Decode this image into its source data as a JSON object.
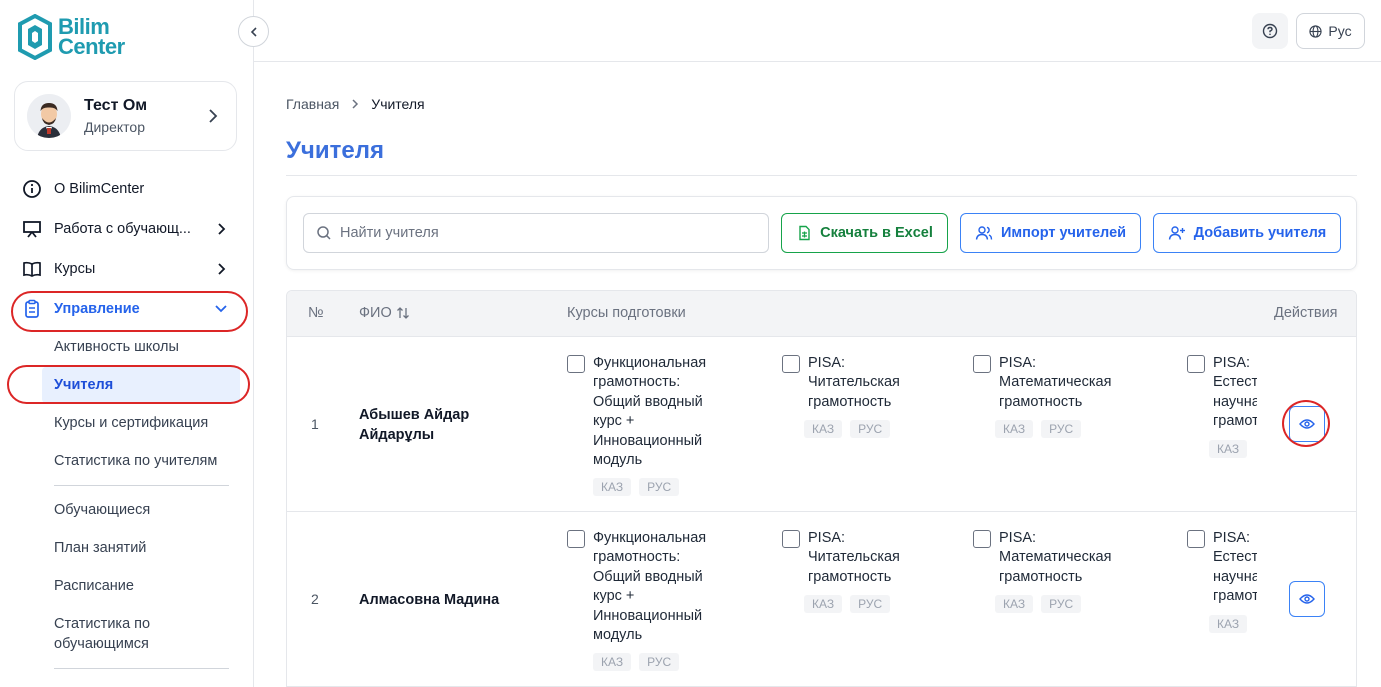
{
  "brand": {
    "line1": "Bilim",
    "line2": "Center"
  },
  "user": {
    "name": "Тест Ом",
    "role": "Директор"
  },
  "nav": {
    "about": "О BilimCenter",
    "work": "Работа с обучающ...",
    "courses": "Курсы",
    "management": "Управление"
  },
  "subnav": {
    "activity": "Активность школы",
    "teachers": "Учителя",
    "courses_cert": "Курсы и сертификация",
    "teacher_stats": "Статистика по учителям",
    "students": "Обучающиеся",
    "lesson_plan": "План занятий",
    "schedule": "Расписание",
    "student_stats": "Статистика по обучающимся"
  },
  "header": {
    "lang": "Рус"
  },
  "breadcrumb": {
    "home": "Главная",
    "current": "Учителя"
  },
  "page": {
    "title": "Учителя"
  },
  "toolbar": {
    "search_placeholder": "Найти учителя",
    "excel": "Скачать в Excel",
    "import": "Импорт учителей",
    "add": "Добавить учителя"
  },
  "table": {
    "headers": {
      "num": "№",
      "name": "ФИО",
      "courses": "Курсы подготовки",
      "actions": "Действия"
    },
    "course_names": [
      "Функциональная грамотность: Общий вводный курс + Инновационный модуль",
      "PISA: Читательская грамотность",
      "PISA: Математическая грамотность",
      "PISA: Естественно-научная грамотность"
    ],
    "lang_tags": [
      "КАЗ",
      "РУС"
    ],
    "rows": [
      {
        "num": "1",
        "name": "Абышев Айдар Айдарұлы"
      },
      {
        "num": "2",
        "name": "Алмасовна Мадина"
      }
    ]
  },
  "colors": {
    "accent": "#2563eb",
    "title": "#3b6fdc",
    "excel": "#16a34a",
    "highlight_ring": "#dc2626"
  }
}
